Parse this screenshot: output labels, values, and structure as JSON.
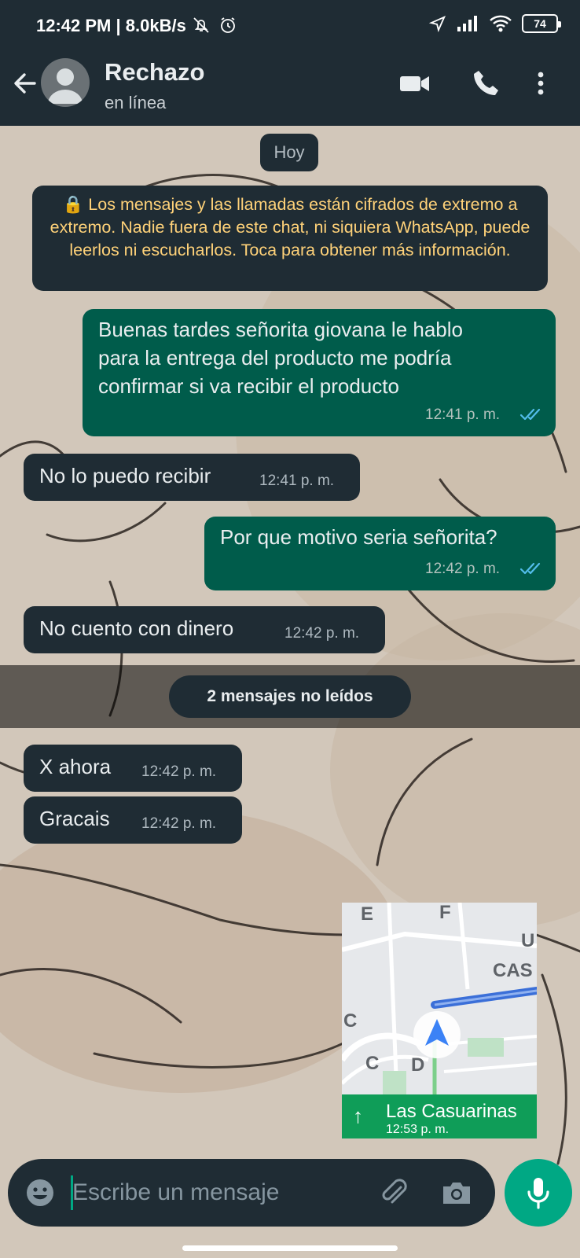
{
  "status_bar": {
    "time": "12:42 PM | 8.0kB/s",
    "battery": "74",
    "icons": [
      "bell-off-icon",
      "alarm-icon",
      "location-icon",
      "signal-icon",
      "wifi-icon",
      "battery-icon"
    ]
  },
  "header": {
    "contact_name": "Rechazo",
    "contact_status": "en línea",
    "icons": [
      "back-arrow-icon",
      "avatar",
      "video-call-icon",
      "voice-call-icon",
      "more-options-icon"
    ]
  },
  "chat": {
    "date_chip": "Hoy",
    "encryption_notice": "🔒 Los mensajes y las llamadas están cifrados de extremo a extremo. Nadie fuera de este chat, ni siquiera WhatsApp, puede leerlos ni escucharlos. Toca para obtener más información.",
    "messages": [
      {
        "direction": "outgoing",
        "text": "Buenas tardes señorita giovana le hablo\npara la entrega del producto me podría\nconfirmar si va recibir el producto",
        "time": "12:41 p. m.",
        "status": "read"
      },
      {
        "direction": "incoming",
        "text": "No lo puedo recibir",
        "time": "12:41 p. m."
      },
      {
        "direction": "outgoing",
        "text": "Por que motivo seria señorita?",
        "time": "12:42 p. m.",
        "status": "read"
      },
      {
        "direction": "incoming",
        "text": "No cuento con dinero",
        "time": "12:42 p. m."
      },
      {
        "direction": "incoming",
        "text": "X ahora",
        "time": "12:42 p. m."
      },
      {
        "direction": "incoming",
        "text": "Gracais",
        "time": "12:42 p. m."
      }
    ],
    "unread_divider": "2 mensajes no leídos"
  },
  "map_overlay": {
    "labels": [
      "E",
      "F",
      "U",
      "CAS",
      "C",
      "C",
      "D"
    ],
    "street": "Las Casuarinas",
    "eta": "12:53 p. m.",
    "colors": {
      "route": "#3b6fd8",
      "nav_bar": "#0f9d58"
    }
  },
  "composer": {
    "placeholder": "Escribe un mensaje",
    "icons": [
      "emoji-icon",
      "attach-icon",
      "camera-icon",
      "mic-icon"
    ]
  },
  "colors": {
    "header_bg": "#1f2c34",
    "outgoing_bubble": "#005c4b",
    "incoming_bubble": "#1f2c34",
    "accent": "#00a884",
    "read_ticks": "#53bdeb",
    "notice_text": "#ffd279"
  }
}
